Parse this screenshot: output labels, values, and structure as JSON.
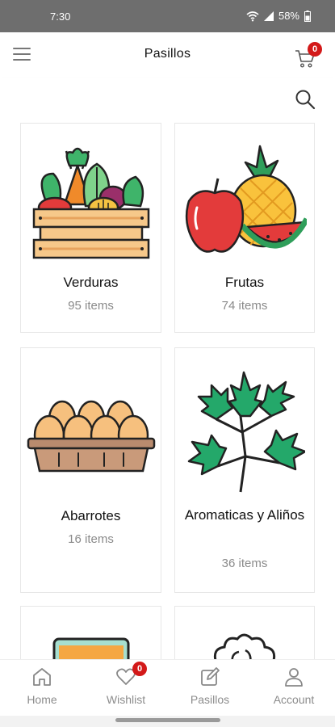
{
  "status": {
    "time": "7:30",
    "battery": "58%"
  },
  "header": {
    "title": "Pasillos",
    "cart_count": "0"
  },
  "categories": [
    {
      "name": "Verduras",
      "count": "95 items",
      "icon": "vegetables-crate-icon"
    },
    {
      "name": "Frutas",
      "count": "74 items",
      "icon": "fruits-icon"
    },
    {
      "name": "Abarrotes",
      "count": "16 items",
      "icon": "eggs-carton-icon"
    },
    {
      "name": "Aromaticas y Aliños",
      "count": "36 items",
      "icon": "herbs-icon"
    }
  ],
  "bottom_nav": {
    "home": "Home",
    "wishlist": "Wishlist",
    "wishlist_count": "0",
    "pasillos": "Pasillos",
    "account": "Account"
  }
}
